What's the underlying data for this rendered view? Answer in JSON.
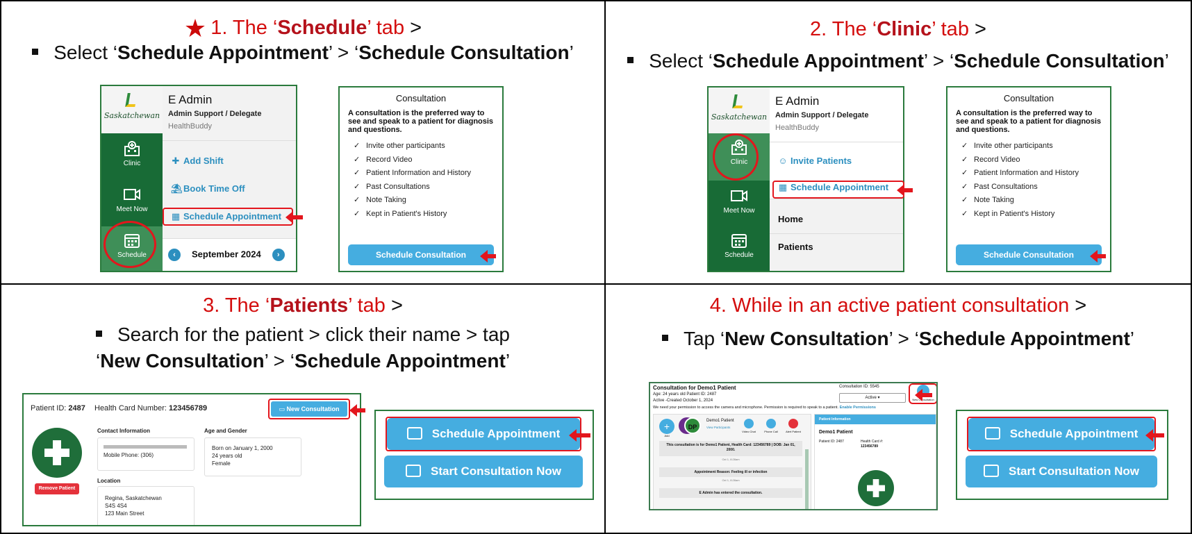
{
  "panel1": {
    "num": "1. The ‘",
    "tab": "Schedule",
    "tail": "’ tab",
    "gt": " >",
    "instr_pre": "Select ‘",
    "instr_b1": "Schedule Appointment",
    "instr_mid": "’ > ‘",
    "instr_b2": "Schedule Consultation",
    "instr_end": "’"
  },
  "panel2": {
    "num": "2. The ‘",
    "tab": "Clinic",
    "tail": "’ tab",
    "gt": " >",
    "instr_pre": "Select ‘",
    "instr_b1": "Schedule Appointment",
    "instr_mid": "’ > ‘",
    "instr_b2": "Schedule Consultation",
    "instr_end": "’"
  },
  "panel3": {
    "num": "3. The ‘",
    "tab": "Patients",
    "tail": "’ tab",
    "gt": " >",
    "instr1": "Search for the patient > click their name > tap",
    "instr2_pre": "‘",
    "instr2_b1": "New Consultation",
    "instr2_mid": "’ > ‘",
    "instr2_b2": "Schedule Appointment",
    "instr2_end": "’"
  },
  "panel4": {
    "heading": "4. While in an active patient consultation",
    "gt": " >",
    "instr_pre": "Tap ‘",
    "instr_b1": "New Consultation",
    "instr_mid": "’ > ‘",
    "instr_b2": "Schedule Appointment",
    "instr_end": "’"
  },
  "app": {
    "logo": "Saskatchewan",
    "user_name": "E Admin",
    "user_role": "Admin Support / Delegate",
    "user_org": "HealthBuddy",
    "nav_clinic": "Clinic",
    "nav_meet": "Meet Now",
    "nav_schedule": "Schedule",
    "add_shift": "Add Shift",
    "book_time_off": "Book Time Off",
    "schedule_appointment": "Schedule Appointment",
    "calendar_month": "September 2024",
    "invite_patients": "Invite Patients",
    "home": "Home",
    "patients": "Patients"
  },
  "consultation": {
    "title": "Consultation",
    "desc": "A consultation is the preferred way to see and speak to a patient for diagnosis and questions.",
    "features": [
      "Invite other participants",
      "Record Video",
      "Patient Information and History",
      "Past Consultations",
      "Note Taking",
      "Kept in Patient's History"
    ],
    "button": "Schedule Consultation"
  },
  "patient": {
    "id_label": "Patient ID:",
    "id": "2487",
    "hc_label": "Health Card Number:",
    "hc": "123456789",
    "new_consult": "New Consultation",
    "contact_label": "Contact Information",
    "mobile": "Mobile Phone: (306)",
    "age_gender_label": "Age and Gender",
    "born": "Born on January 1, 2000",
    "age": "24 years old",
    "gender": "Female",
    "remove": "Remove Patient",
    "location_label": "Location",
    "city": "Regina, Saskatchewan",
    "postal": "S4S 4S4",
    "street": "123 Main Street"
  },
  "actions": {
    "schedule_appointment": "Schedule Appointment",
    "start_now": "Start Consultation Now"
  },
  "active": {
    "title": "Consultation for Demo1 Patient",
    "sub1": "Age: 24 years old   Patient ID: 2487",
    "sub2": "Active -Created October 1, 2024",
    "consult_id": "Consultation ID: 5545",
    "status": "Active ▾",
    "new_label": "New Consultation",
    "permission": "We need your permission to access the camera and microphone. Permission is required to speak to a patient.",
    "enable": "Enable Permissions",
    "participant": "Demo1 Patient",
    "view_participants": "View Participants",
    "initials": "DP",
    "add": "Add",
    "video_chat": "Video Chat",
    "phone_call": "Phone Call",
    "alert": "Alert Patient",
    "msg1": "This consultation is for Demo1 Patient, Health Card: 123456789 | DOB: Jan 01, 2000.",
    "time1": "Oct 1, 8:28am",
    "msg2": "Appointment Reason: Feeling ill or infection",
    "time2": "Oct 1, 8:28am",
    "msg3": "E Admin has entered the consultation.",
    "info_header": "Patient Information",
    "info_name": "Demo1 Patient",
    "info_id": "Patient ID: 2487",
    "info_hc_label": "Health Card #:",
    "info_hc": "123456789"
  }
}
